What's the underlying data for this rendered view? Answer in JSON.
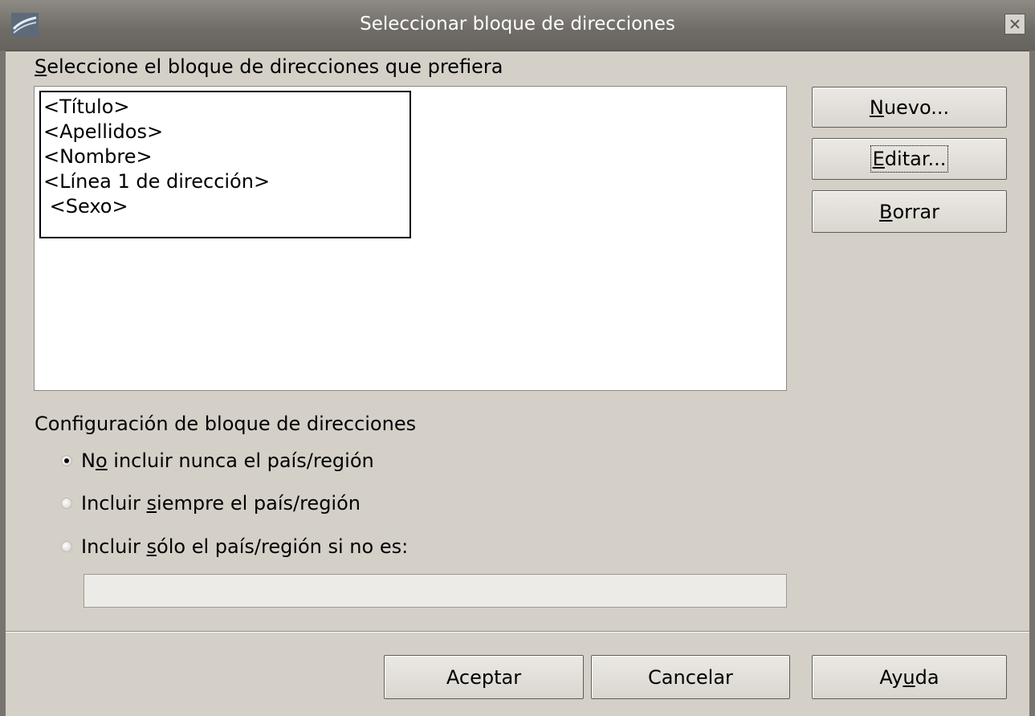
{
  "window": {
    "title": "Seleccionar bloque de direcciones",
    "app_icon": "office-logo-icon",
    "close_icon": "close-icon"
  },
  "blocks": {
    "label_first": "S",
    "label_rest": "eleccione el bloque de direcciones que prefiera",
    "items": [
      {
        "lines": [
          "<Título>",
          "<Apellidos>",
          "<Nombre>",
          "<Línea 1 de dirección>",
          " <Sexo>"
        ]
      }
    ]
  },
  "side_buttons": {
    "new": {
      "u": "N",
      "rest": "uevo..."
    },
    "edit": {
      "u": "E",
      "rest": "ditar..."
    },
    "delete": {
      "u": "B",
      "rest": "orrar"
    }
  },
  "config": {
    "label": "Configuración de bloque de direcciones",
    "options": [
      {
        "pre": "N",
        "u": "o",
        "post": " incluir nunca el país/región",
        "selected": true
      },
      {
        "pre": "Incluir ",
        "u": "s",
        "post": "iempre el país/región",
        "selected": false
      },
      {
        "pre": "Incluir ",
        "u": "s",
        "post": "ólo el país/región si no es:",
        "selected": false
      }
    ],
    "country_value": ""
  },
  "footer_buttons": {
    "ok": "Aceptar",
    "cancel": "Cancelar",
    "help": {
      "pre": "Ay",
      "u": "u",
      "post": "da"
    }
  },
  "colors": {
    "dialog_bg": "#d4d0c8",
    "titlebar": "#6f6b66",
    "list_bg": "#ffffff"
  }
}
